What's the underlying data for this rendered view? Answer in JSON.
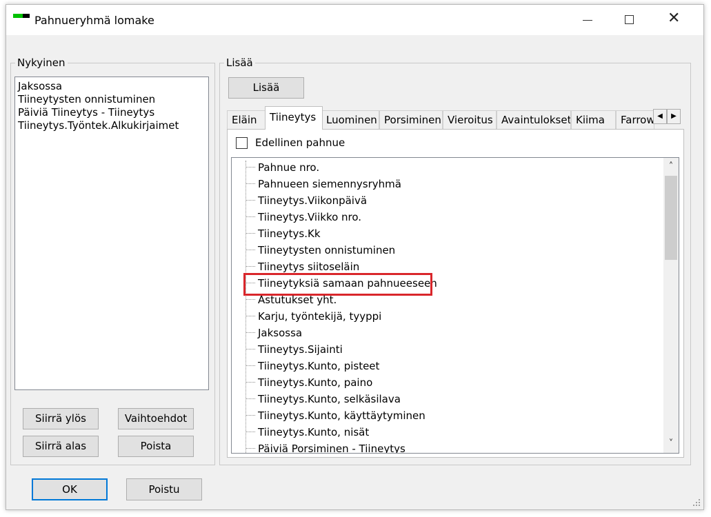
{
  "window": {
    "title": "Pahnueryhmä lomake",
    "close_glyph": "✕"
  },
  "current": {
    "label": "Nykyinen",
    "items": [
      "Jaksossa",
      "Tiineytysten onnistuminen",
      "Päiviä Tiineytys - Tiineytys",
      "Tiineytys.Työntek.Alkukirjaimet"
    ],
    "buttons": {
      "move_up": "Siirrä ylös",
      "options": "Vaihtoehdot",
      "move_down": "Siirrä alas",
      "remove": "Poista"
    }
  },
  "add": {
    "label": "Lisää",
    "button": "Lisää",
    "tabs": [
      "Eläin",
      "Tiineytys",
      "Luominen",
      "Porsiminen",
      "Vieroitus",
      "Avaintulokset",
      "Kiima",
      "Farrow"
    ],
    "active_tab_index": 1,
    "tab_scroll_left": "◀",
    "tab_scroll_right": "▶",
    "previous_litter_label": "Edellinen pahnue",
    "tree_items": [
      "Pahnue nro.",
      "Pahnueen siemennysryhmä",
      "Tiineytys.Viikonpäivä",
      "Tiineytys.Viikko nro.",
      "Tiineytys.Kk",
      "Tiineytysten onnistuminen",
      "Tiineytys siitoseläin",
      "Tiineytyksiä samaan pahnueeseen",
      "Astutukset yht.",
      "Karju, työntekijä, tyyppi",
      "Jaksossa",
      "Tiineytys.Sijainti",
      "Tiineytys.Kunto, pisteet",
      "Tiineytys.Kunto, paino",
      "Tiineytys.Kunto, selkäsilava",
      "Tiineytys.Kunto, käyttäytyminen",
      "Tiineytys.Kunto, nisät",
      "Päiviä Porsiminen - Tiineytys"
    ],
    "highlighted_index": 7,
    "scroll_up": "˄",
    "scroll_down": "˅"
  },
  "footer": {
    "ok": "OK",
    "exit": "Poistu"
  },
  "colors": {
    "highlight": "#d9262b",
    "default_button_border": "#0078d7",
    "icon_green": "#00c000"
  }
}
